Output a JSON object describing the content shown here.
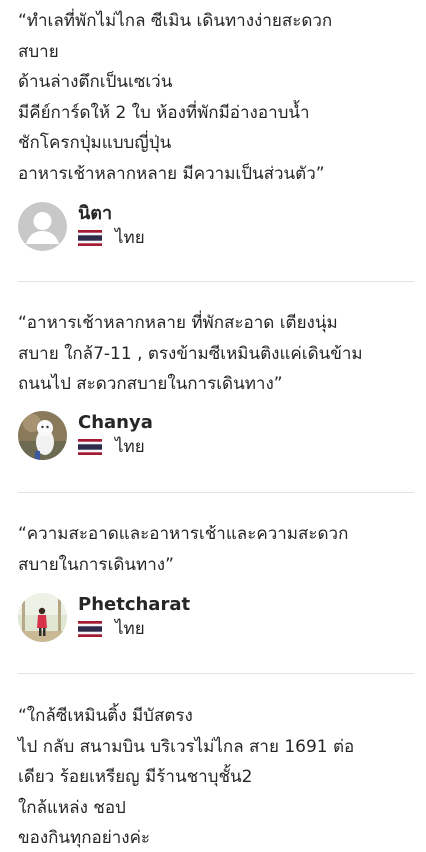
{
  "reviews": [
    {
      "text": "“ทำเลที่พักไม่ไกล ซีเมิน เดินทางง่ายสะดวก\nสบาย\nด้านล่างตึกเป็นเซเว่น\nมีคีย์การ์ดให้ 2 ใบ ห้องที่พักมีอ่างอาบน้ำ\nชักโครกปุ่มแบบญี่ปุ่น\nอาหารเช้าหลากหลาย มีความเป็นส่วนตัว”",
      "reviewer": "นิตา",
      "country": "ไทย",
      "avatar": "default-person-icon"
    },
    {
      "text": "“อาหารเช้าหลากหลาย ที่พักสะอาด เตียงนุ่ม\nสบาย ใกล้7-11 , ตรงข้ามซีเหมินติงแค่เดินข้าม\nถนนไป สะดวกสบายในการเดินทาง”",
      "reviewer": "Chanya",
      "country": "ไทย",
      "avatar": "photo-avatar"
    },
    {
      "text": "“ความสะอาดและอาหารเช้าและความสะดวก\nสบายในการเดินทาง”",
      "reviewer": "Phetcharat",
      "country": "ไทย",
      "avatar": "photo-avatar"
    },
    {
      "text": "“ใกล้ซีเหมินติ้ง มีบัสตรง\nไป กลับ สนามบิน บริเวรไม่ไกล สาย 1691 ต่อ\nเดียว ร้อยเหรียญ มีร้านชาบุชั้น2\nใกล้แหล่ง ชอป\nของกินทุกอย่างค่ะ"
    }
  ],
  "flag": {
    "icon": "thailand-flag-icon",
    "colors": [
      "#A51931",
      "#F4F5F8",
      "#2D2A4A"
    ]
  },
  "colors": {
    "text": "#262626",
    "divider": "#e4e4e4",
    "avatar_placeholder": "#c8c8c8"
  }
}
